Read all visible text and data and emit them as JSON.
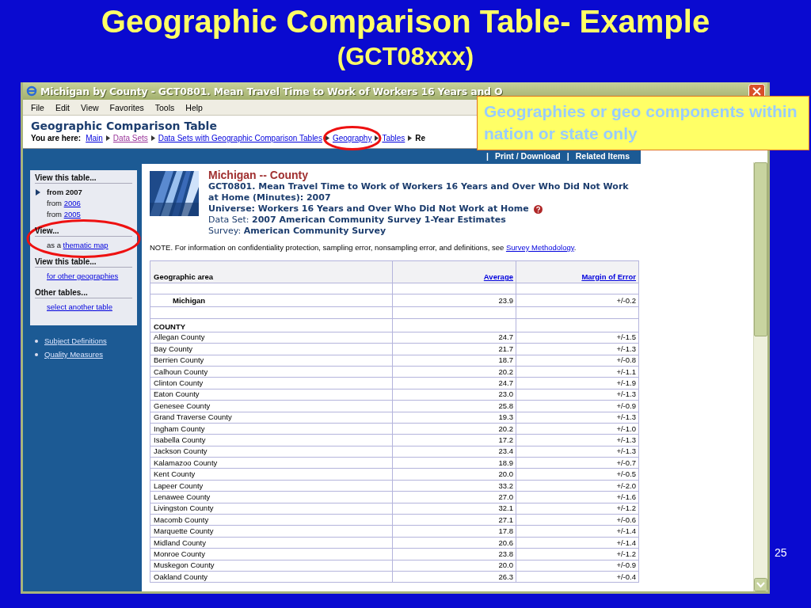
{
  "slide": {
    "title": "Geographic Comparison Table- Example",
    "subtitle": "(GCT08xxx)",
    "page_number": "25"
  },
  "window": {
    "title": "Michigan by County - GCT0801. Mean Travel Time to Work of Workers 16 Years and O"
  },
  "menu": [
    "File",
    "Edit",
    "View",
    "Favorites",
    "Tools",
    "Help"
  ],
  "page": {
    "heading": "Geographic Comparison Table",
    "breadcrumb_label": "You are here:",
    "breadcrumb": [
      {
        "label": "Main",
        "kind": "link",
        "circled": false
      },
      {
        "label": "Data Sets",
        "kind": "visited",
        "circled": false
      },
      {
        "label": "Data Sets with Geographic Comparison Tables",
        "kind": "link",
        "circled": false
      },
      {
        "label": "Geography",
        "kind": "link",
        "circled": true
      },
      {
        "label": "Tables",
        "kind": "link",
        "circled": false
      },
      {
        "label": "Re",
        "kind": "current",
        "circled": false
      }
    ]
  },
  "toolbar": {
    "separator": "|",
    "links": [
      "Print / Download",
      "Related Items"
    ]
  },
  "sidebar": {
    "sections": [
      {
        "heading": "View this table...",
        "circled": false,
        "items": [
          {
            "text": "from 2007",
            "selected": true
          },
          {
            "text": "from",
            "link": "2006",
            "selected": false
          },
          {
            "text": "from",
            "link": "2005",
            "selected": false
          }
        ]
      },
      {
        "heading": "View...",
        "circled": true,
        "items": [
          {
            "text": "as a",
            "link": "thematic map"
          }
        ]
      },
      {
        "heading": "View this table...",
        "circled": false,
        "items": [
          {
            "link": "for other geographies"
          }
        ]
      },
      {
        "heading": "Other tables...",
        "circled": false,
        "items": [
          {
            "link": "select another table"
          }
        ]
      }
    ],
    "extra_links": [
      "Subject Definitions",
      "Quality Measures"
    ]
  },
  "report": {
    "geography": "Michigan -- County",
    "table_title": "GCT0801. Mean Travel Time to Work of Workers 16 Years and Over Who Did Not Work at Home (Minutes): 2007",
    "universe": "Universe: Workers 16 Years and Over Who Did Not Work at Home",
    "dataset": "Data Set: **2007 American Community Survey 1-Year Estimates**",
    "survey": "Survey: **American Community Survey**",
    "note": "NOTE. For information on confidentiality protection, sampling error, nonsampling error, and definitions, see",
    "note_link": "Survey Methodology",
    "note_end": "."
  },
  "table": {
    "columns": [
      "Geographic area",
      "Average",
      "Margin of Error"
    ],
    "rows": [
      {
        "kind": "blank"
      },
      {
        "kind": "total",
        "cells": [
          "Michigan",
          "23.9",
          "+/-0.2"
        ]
      },
      {
        "kind": "blank"
      },
      {
        "kind": "section",
        "cells": [
          "COUNTY"
        ]
      },
      {
        "kind": "data",
        "cells": [
          "Allegan County",
          "24.7",
          "+/-1.5"
        ]
      },
      {
        "kind": "data",
        "cells": [
          "Bay County",
          "21.7",
          "+/-1.3"
        ]
      },
      {
        "kind": "data",
        "cells": [
          "Berrien County",
          "18.7",
          "+/-0.8"
        ]
      },
      {
        "kind": "data",
        "cells": [
          "Calhoun County",
          "20.2",
          "+/-1.1"
        ]
      },
      {
        "kind": "data",
        "cells": [
          "Clinton County",
          "24.7",
          "+/-1.9"
        ]
      },
      {
        "kind": "data",
        "cells": [
          "Eaton County",
          "23.0",
          "+/-1.3"
        ]
      },
      {
        "kind": "data",
        "cells": [
          "Genesee County",
          "25.8",
          "+/-0.9"
        ]
      },
      {
        "kind": "data",
        "cells": [
          "Grand Traverse County",
          "19.3",
          "+/-1.3"
        ]
      },
      {
        "kind": "data",
        "cells": [
          "Ingham County",
          "20.2",
          "+/-1.0"
        ]
      },
      {
        "kind": "data",
        "cells": [
          "Isabella County",
          "17.2",
          "+/-1.3"
        ]
      },
      {
        "kind": "data",
        "cells": [
          "Jackson County",
          "23.4",
          "+/-1.3"
        ]
      },
      {
        "kind": "data",
        "cells": [
          "Kalamazoo County",
          "18.9",
          "+/-0.7"
        ]
      },
      {
        "kind": "data",
        "cells": [
          "Kent County",
          "20.0",
          "+/-0.5"
        ]
      },
      {
        "kind": "data",
        "cells": [
          "Lapeer County",
          "33.2",
          "+/-2.0"
        ]
      },
      {
        "kind": "data",
        "cells": [
          "Lenawee County",
          "27.0",
          "+/-1.6"
        ]
      },
      {
        "kind": "data",
        "cells": [
          "Livingston County",
          "32.1",
          "+/-1.2"
        ]
      },
      {
        "kind": "data",
        "cells": [
          "Macomb County",
          "27.1",
          "+/-0.6"
        ]
      },
      {
        "kind": "data",
        "cells": [
          "Marquette County",
          "17.8",
          "+/-1.4"
        ]
      },
      {
        "kind": "data",
        "cells": [
          "Midland County",
          "20.6",
          "+/-1.4"
        ]
      },
      {
        "kind": "data",
        "cells": [
          "Monroe County",
          "23.8",
          "+/-1.2"
        ]
      },
      {
        "kind": "data",
        "cells": [
          "Muskegon County",
          "20.0",
          "+/-0.9"
        ]
      },
      {
        "kind": "data",
        "cells": [
          "Oakland County",
          "26.3",
          "+/-0.4"
        ]
      }
    ]
  },
  "callout": {
    "text": "Geographies or geo components within nation or state only"
  }
}
